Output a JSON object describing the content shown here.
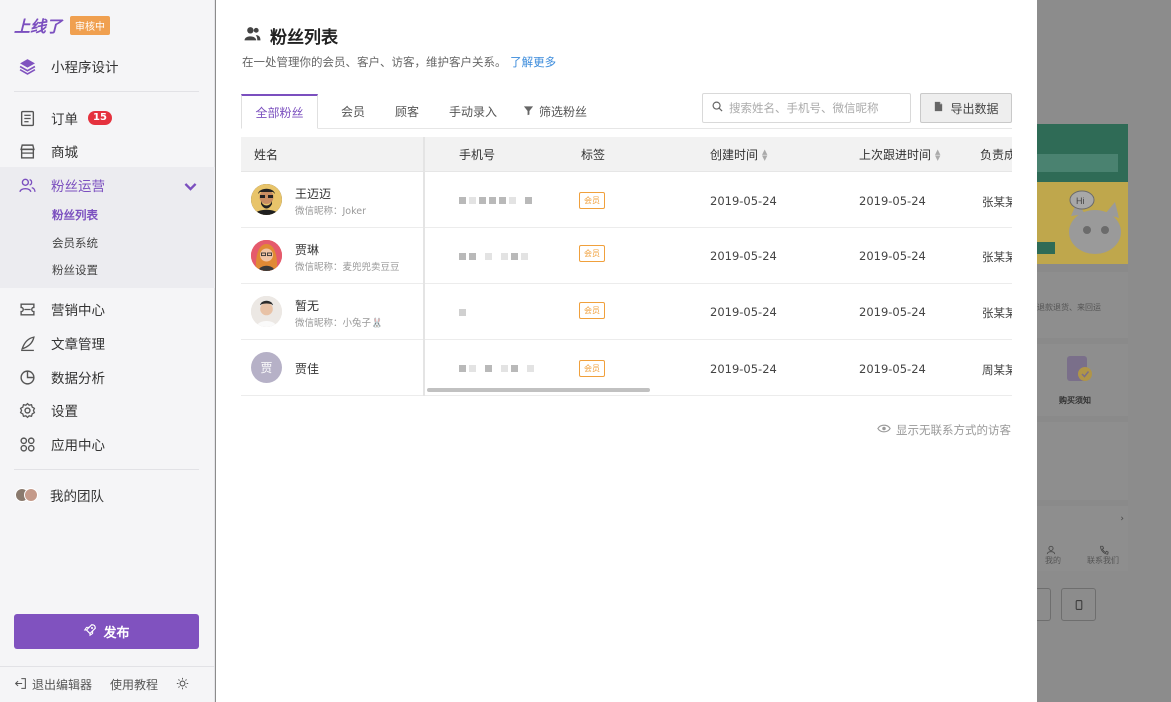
{
  "brand": {
    "logo": "上线了",
    "status_badge": "审核中"
  },
  "sidebar": {
    "design": "小程序设计",
    "items": [
      {
        "label": "订单",
        "badge": "15"
      },
      {
        "label": "商城"
      },
      {
        "label": "粉丝运营"
      },
      {
        "label": "营销中心"
      },
      {
        "label": "文章管理"
      },
      {
        "label": "数据分析"
      },
      {
        "label": "设置"
      },
      {
        "label": "应用中心"
      }
    ],
    "fan_sub": [
      "粉丝列表",
      "会员系统",
      "粉丝设置"
    ],
    "team": "我的团队",
    "publish": "发布",
    "footer": {
      "exit": "退出编辑器",
      "tutorial": "使用教程"
    }
  },
  "page": {
    "title": "粉丝列表",
    "subtitle": "在一处管理你的会员、客户、访客，维护客户关系。",
    "learn_more": "了解更多"
  },
  "tabs": [
    "全部粉丝",
    "会员",
    "顾客",
    "手动录入",
    "筛选粉丝"
  ],
  "search": {
    "placeholder": "搜索姓名、手机号、微信昵称"
  },
  "export_label": "导出数据",
  "table": {
    "headers": [
      "姓名",
      "手机号",
      "标签",
      "创建时间",
      "上次跟进时间",
      "负责成"
    ],
    "rows": [
      {
        "name": "王迈迈",
        "nickname": "微信昵称：Joker",
        "tag": "会员",
        "created": "2019-05-24",
        "followed": "2019-05-24",
        "owner": "张某某",
        "avatar_color": "#3b3b3b"
      },
      {
        "name": "贾琳",
        "nickname": "微信昵称：麦兜兜卖豆豆",
        "tag": "会员",
        "created": "2019-05-24",
        "followed": "2019-05-24",
        "owner": "张某某",
        "avatar_color": "#d9534f"
      },
      {
        "name": "暂无",
        "nickname": "微信昵称：小兔子🐰",
        "tag": "会员",
        "created": "2019-05-24",
        "followed": "2019-05-24",
        "owner": "张某某",
        "avatar_color": "#d8cfc8"
      },
      {
        "name": "贾佳",
        "nickname": "",
        "tag": "会员",
        "created": "2019-05-24",
        "followed": "2019-05-24",
        "owner": "周某某",
        "avatar_letter": "贾",
        "avatar_color": "#b6b1c7"
      }
    ]
  },
  "show_no_contact": "显示无联系方式的访客",
  "preview": {
    "shipping_note": "退款退货、来回运",
    "purchase_note": "购买须知",
    "bottom_nav": [
      "我的",
      "联系我们"
    ]
  },
  "colors": {
    "accent": "#7b4fbf",
    "badge_red": "#e5323e",
    "tag_orange": "#f0a03c",
    "link_blue": "#3b8bdb"
  }
}
